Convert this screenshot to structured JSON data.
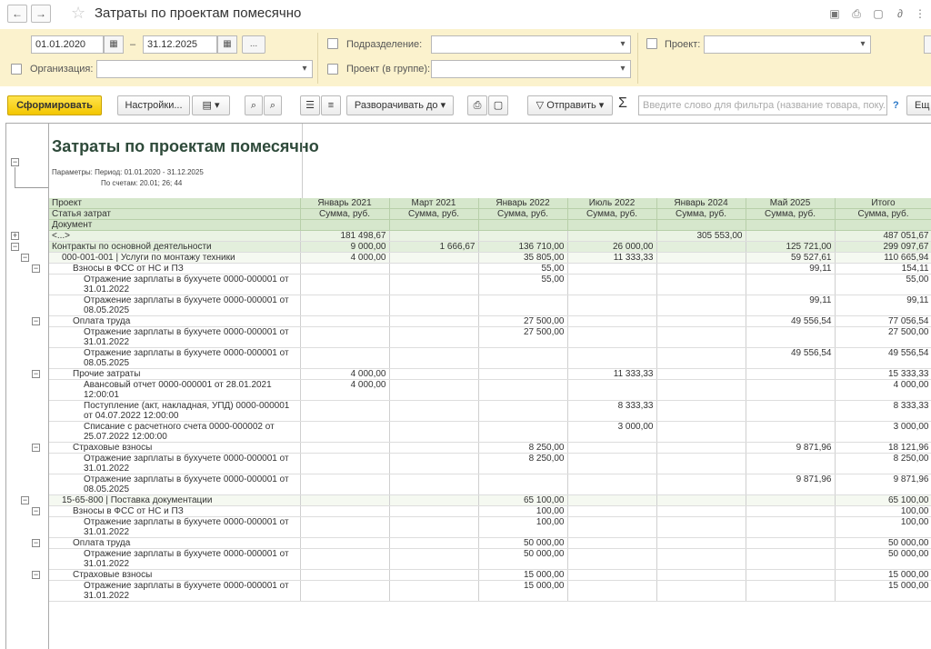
{
  "window": {
    "title": "Затраты по проектам помесячно",
    "nav_back": "←",
    "nav_fwd": "→"
  },
  "filters": {
    "date_from": "01.01.2020",
    "date_sep": "–",
    "date_to": "31.12.2025",
    "period_more": "...",
    "org_label": "Организация:",
    "subdivision_label": "Подразделение:",
    "project_group_label": "Проект (в группе):",
    "project_label": "Проект:"
  },
  "toolbar": {
    "generate": "Сформировать",
    "settings": "Настройки...",
    "expand_to": "Разворачивать до",
    "send": "Отправить",
    "sigma": "Σ",
    "search_placeholder": "Введите слово для фильтра (название товара, поку...",
    "help": "?",
    "more": "Ещ"
  },
  "report": {
    "title": "Затраты по проектам помесячно",
    "params_line1": "Параметры: Период: 01.01.2020 - 31.12.2025",
    "params_line2": "По счетам: 20.01; 26; 44",
    "header": {
      "row_labels": [
        "Проект",
        "Статья затрат",
        "Документ"
      ],
      "columns": [
        "Январь 2021",
        "Март 2021",
        "Январь 2022",
        "Июль 2022",
        "Январь 2024",
        "Май 2025",
        "Итого"
      ],
      "sub": "Сумма, руб."
    },
    "rows": [
      {
        "type": "grp",
        "label": "<...>",
        "v": [
          "181 498,67",
          "",
          "",
          "",
          "305 553,00",
          "",
          "487 051,67"
        ]
      },
      {
        "type": "grp1",
        "label": "Контракты по основной деятельности",
        "v": [
          "9 000,00",
          "1 666,67",
          "136 710,00",
          "26 000,00",
          "",
          "125 721,00",
          "299 097,67"
        ]
      },
      {
        "type": "lvl1",
        "label": "000-001-001 | Услуги по монтажу техники",
        "v": [
          "4 000,00",
          "",
          "35 805,00",
          "11 333,33",
          "",
          "59 527,61",
          "110 665,94"
        ]
      },
      {
        "type": "art",
        "label": "Взносы в ФСС от НС и ПЗ",
        "v": [
          "",
          "",
          "55,00",
          "",
          "",
          "99,11",
          "154,11"
        ]
      },
      {
        "type": "doc",
        "label": "Отражение зарплаты в бухучете 0000-000001 от 31.01.2022",
        "v": [
          "",
          "",
          "55,00",
          "",
          "",
          "",
          "55,00"
        ]
      },
      {
        "type": "doc",
        "label": "Отражение зарплаты в бухучете 0000-000001 от 08.05.2025",
        "v": [
          "",
          "",
          "",
          "",
          "",
          "99,11",
          "99,11"
        ]
      },
      {
        "type": "art",
        "label": "Оплата труда",
        "v": [
          "",
          "",
          "27 500,00",
          "",
          "",
          "49 556,54",
          "77 056,54"
        ]
      },
      {
        "type": "doc",
        "label": "Отражение зарплаты в бухучете 0000-000001 от 31.01.2022",
        "v": [
          "",
          "",
          "27 500,00",
          "",
          "",
          "",
          "27 500,00"
        ]
      },
      {
        "type": "doc",
        "label": "Отражение зарплаты в бухучете 0000-000001 от 08.05.2025",
        "v": [
          "",
          "",
          "",
          "",
          "",
          "49 556,54",
          "49 556,54"
        ]
      },
      {
        "type": "art",
        "label": "Прочие затраты",
        "v": [
          "4 000,00",
          "",
          "",
          "11 333,33",
          "",
          "",
          "15 333,33"
        ]
      },
      {
        "type": "doc",
        "label": "Авансовый отчет 0000-000001 от 28.01.2021 12:00:01",
        "v": [
          "4 000,00",
          "",
          "",
          "",
          "",
          "",
          "4 000,00"
        ]
      },
      {
        "type": "doc",
        "label": "Поступление (акт, накладная, УПД) 0000-000001 от 04.07.2022 12:00:00",
        "v": [
          "",
          "",
          "",
          "8 333,33",
          "",
          "",
          "8 333,33"
        ]
      },
      {
        "type": "doc",
        "label": "Списание с расчетного счета 0000-000002 от 25.07.2022 12:00:00",
        "v": [
          "",
          "",
          "",
          "3 000,00",
          "",
          "",
          "3 000,00"
        ]
      },
      {
        "type": "art",
        "label": "Страховые взносы",
        "v": [
          "",
          "",
          "8 250,00",
          "",
          "",
          "9 871,96",
          "18 121,96"
        ]
      },
      {
        "type": "doc",
        "label": "Отражение зарплаты в бухучете 0000-000001 от 31.01.2022",
        "v": [
          "",
          "",
          "8 250,00",
          "",
          "",
          "",
          "8 250,00"
        ]
      },
      {
        "type": "doc",
        "label": "Отражение зарплаты в бухучете 0000-000001 от 08.05.2025",
        "v": [
          "",
          "",
          "",
          "",
          "",
          "9 871,96",
          "9 871,96"
        ]
      },
      {
        "type": "lvl1",
        "label": "15-65-800 | Поставка документации",
        "v": [
          "",
          "",
          "65 100,00",
          "",
          "",
          "",
          "65 100,00"
        ]
      },
      {
        "type": "art",
        "label": "Взносы в ФСС от НС и ПЗ",
        "v": [
          "",
          "",
          "100,00",
          "",
          "",
          "",
          "100,00"
        ]
      },
      {
        "type": "doc",
        "label": "Отражение зарплаты в бухучете 0000-000001 от 31.01.2022",
        "v": [
          "",
          "",
          "100,00",
          "",
          "",
          "",
          "100,00"
        ]
      },
      {
        "type": "art",
        "label": "Оплата труда",
        "v": [
          "",
          "",
          "50 000,00",
          "",
          "",
          "",
          "50 000,00"
        ]
      },
      {
        "type": "doc",
        "label": "Отражение зарплаты в бухучете 0000-000001 от 31.01.2022",
        "v": [
          "",
          "",
          "50 000,00",
          "",
          "",
          "",
          "50 000,00"
        ]
      },
      {
        "type": "art",
        "label": "Страховые взносы",
        "v": [
          "",
          "",
          "15 000,00",
          "",
          "",
          "",
          "15 000,00"
        ]
      },
      {
        "type": "doc",
        "label": "Отражение зарплаты в бухучете 0000-000001 от 31.01.2022",
        "v": [
          "",
          "",
          "15 000,00",
          "",
          "",
          "",
          "15 000,00"
        ]
      }
    ]
  },
  "colors": {
    "filter_bg": "#fbf2cd",
    "header_bg": "#d6e7cc",
    "primary_btn": "#f3c600",
    "title_green": "#2e4a3a"
  }
}
